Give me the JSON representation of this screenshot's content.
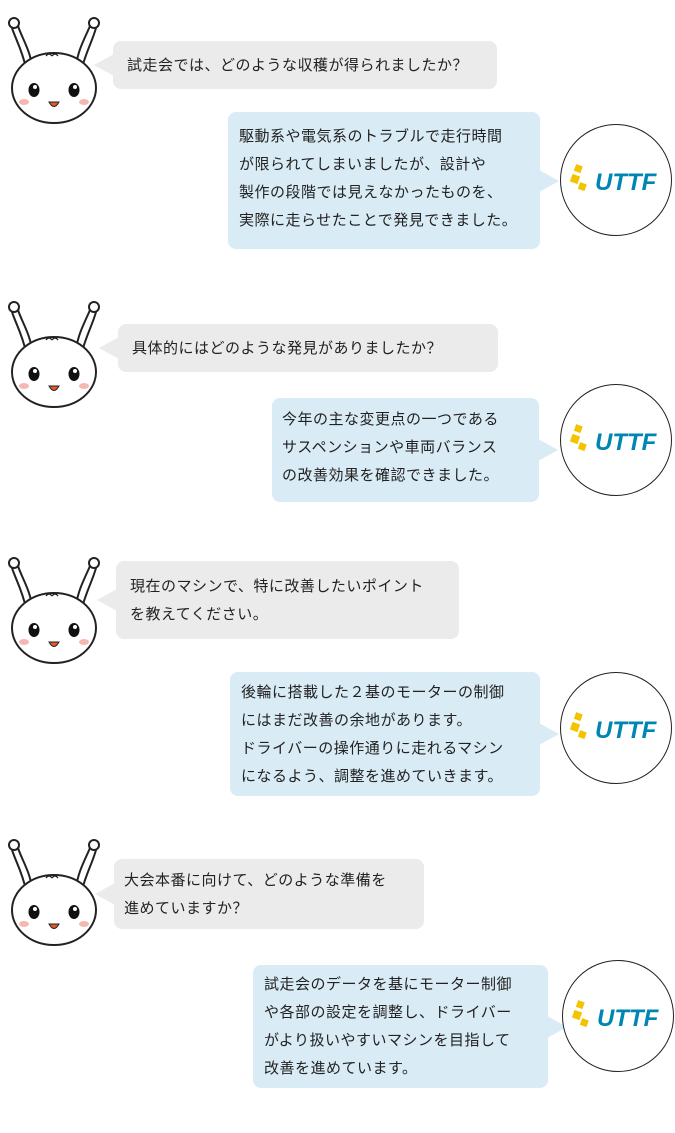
{
  "conversation": [
    {
      "question": "試走会では、どのような収穫が得られましたか？",
      "answer": "駆動系や電気系のトラブルで走行時間\nが限られてしまいましたが、設計や\n製作の段階では見えなかったものを、\n実際に走らせたことで発見できました。"
    },
    {
      "question": "具体的にはどのような発見がありましたか？",
      "answer": "今年の主な変更点の一つである\nサスペンションや車両バランス\nの改善効果を確認できました。"
    },
    {
      "question": "現在のマシンで、特に改善したいポイント\nを教えてください。",
      "answer": "後輪に搭載した２基のモーターの制御\nにはまだ改善の余地があります。\nドライバーの操作通りに走れるマシン\nになるよう、調整を進めていきます。"
    },
    {
      "question": "大会本番に向けて、どのような準備を\n進めていますか？",
      "answer": "試走会のデータを基にモーター制御\nや各部の設定を調整し、ドライバー\nがより扱いやすいマシンを目指して\n改善を進めています。"
    }
  ],
  "logo": {
    "text": "UTTF",
    "colors": {
      "yellow": "#f3c300",
      "blue": "#0086b3"
    }
  },
  "colors": {
    "question_bubble": "#ebebeb",
    "answer_bubble": "#d9ebf5"
  }
}
